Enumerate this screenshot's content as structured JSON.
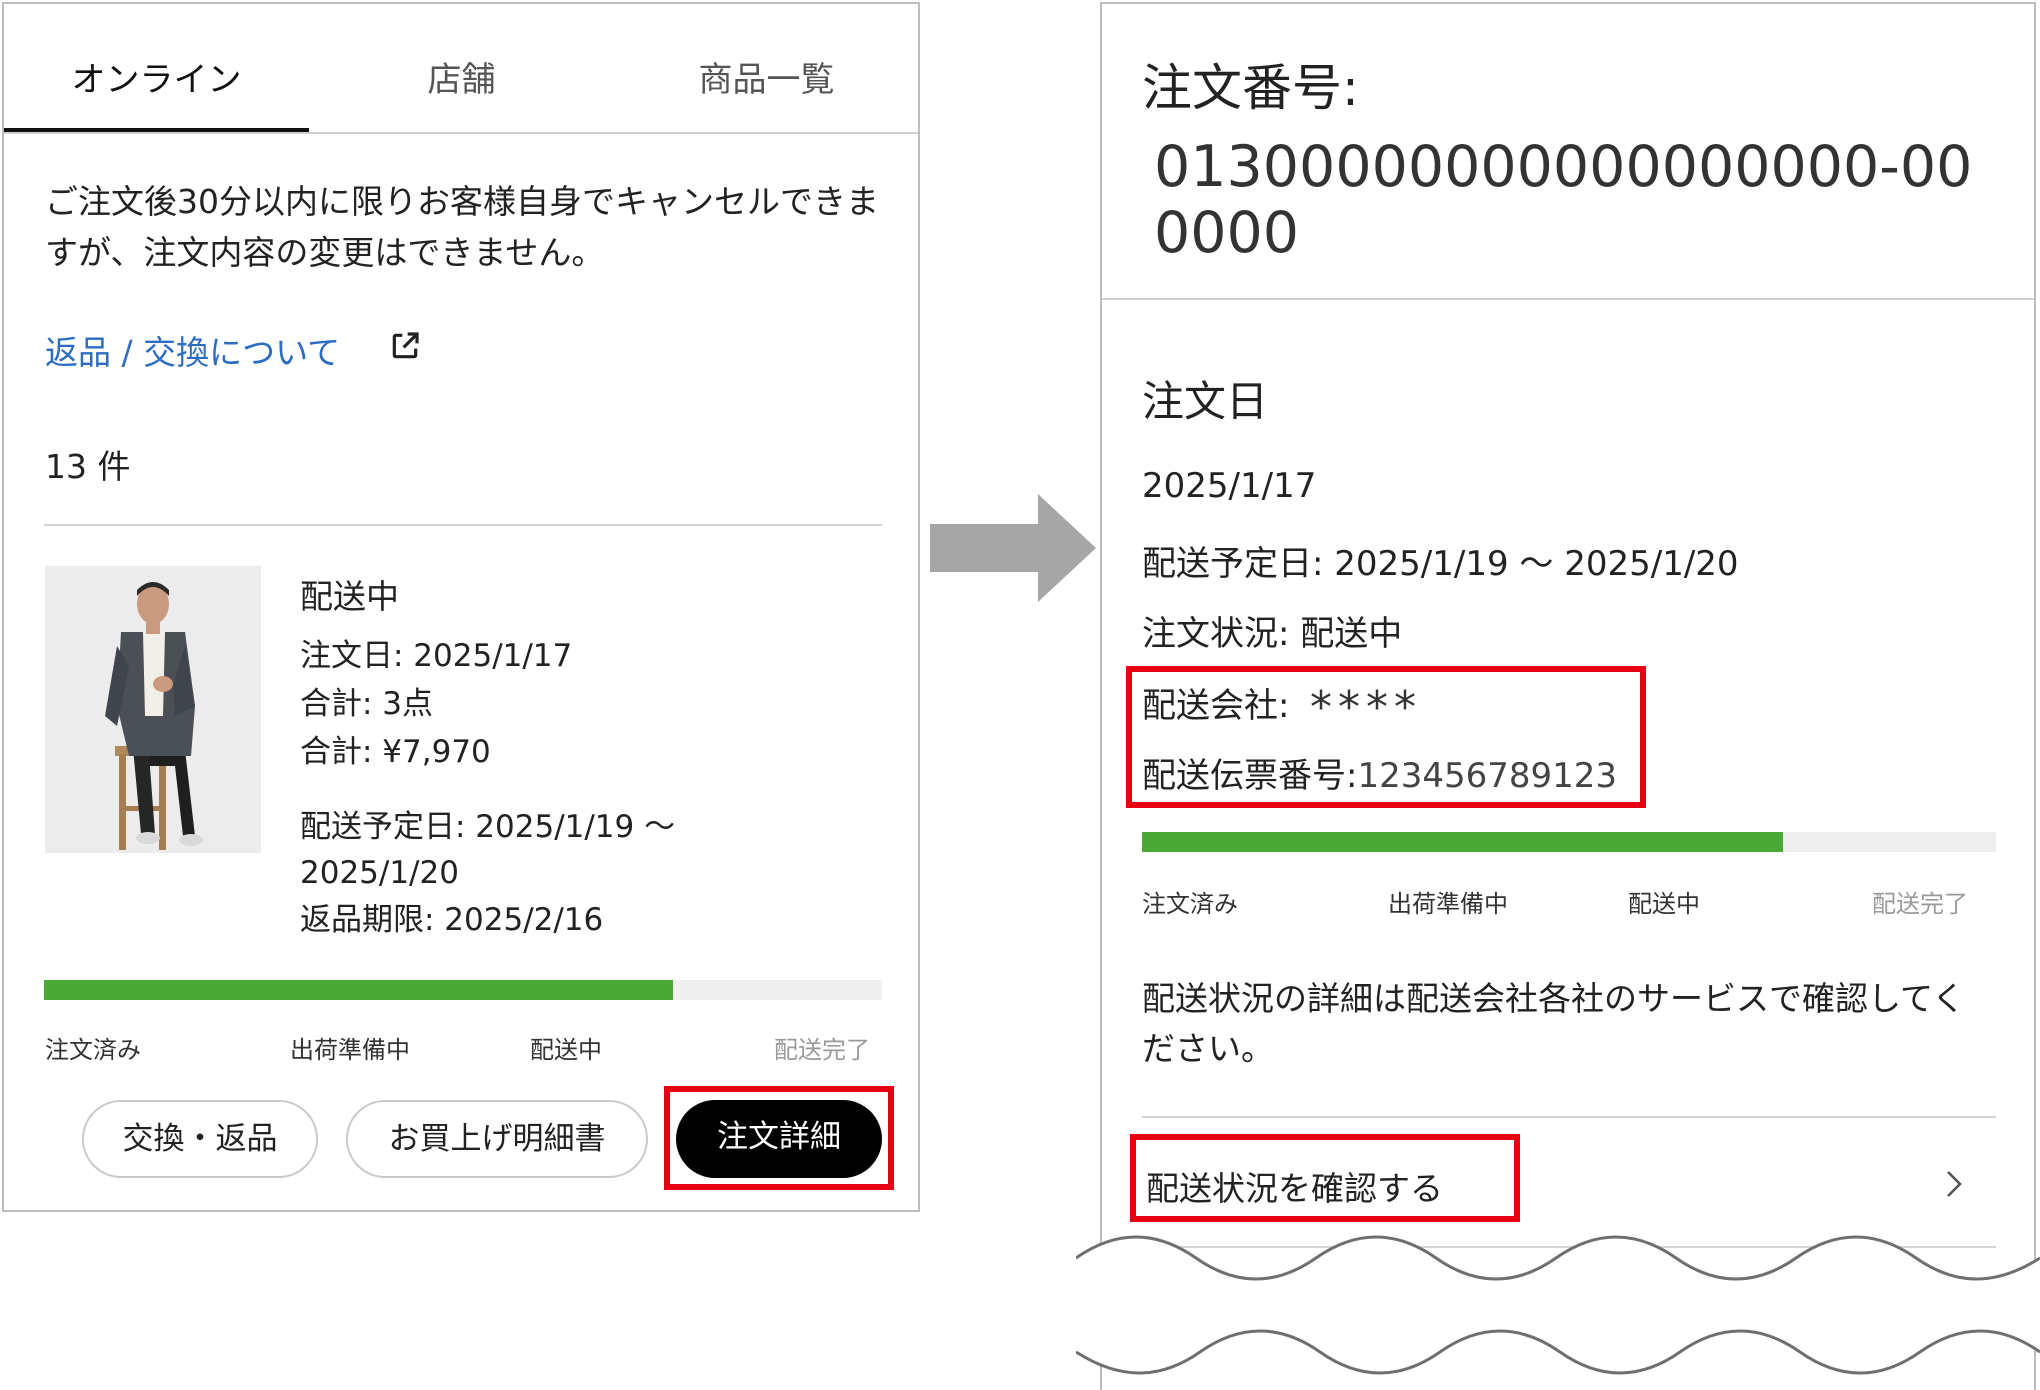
{
  "left": {
    "tabs": [
      {
        "label": "オンライン",
        "active": true
      },
      {
        "label": "店舗",
        "active": false
      },
      {
        "label": "商品一覧",
        "active": false
      }
    ],
    "note": "ご注文後30分以内に限りお客様自身でキャンセルできますが、注文内容の変更はできません。",
    "link": "返品 / 交換について",
    "link_icon": "external-link-icon",
    "count": "13 件",
    "order": {
      "status": "配送中",
      "order_date": "注文日: 2025/1/17",
      "quantity": "合計: 3点",
      "total": "合計: ¥7,970",
      "delivery": "配送予定日: 2025/1/19 〜 2025/1/20",
      "return_limit": "返品期限: 2025/2/16"
    },
    "progress": {
      "fraction": 0.75,
      "labels": [
        "注文済み",
        "出荷準備中",
        "配送中",
        "配送完了"
      ]
    },
    "buttons": {
      "exchange": "交換・返品",
      "receipt": "お買上げ明細書",
      "details": "注文詳細"
    }
  },
  "right": {
    "order_label": "注文番号:",
    "order_number": "01300000000000000000-000000",
    "date_heading": "注文日",
    "date": "2025/1/17",
    "delivery": "配送予定日: 2025/1/19 〜 2025/1/20",
    "status": "注文状況: 配送中",
    "carrier_label": "配送会社:",
    "carrier_value": "****",
    "tracking_label": "配送伝票番号:",
    "tracking_value": "123456789123",
    "progress": {
      "fraction": 0.75,
      "labels": [
        "注文済み",
        "出荷準備中",
        "配送中",
        "配送完了"
      ]
    },
    "note": "配送状況の詳細は配送会社各社のサービスで確認してください。",
    "check_link": "配送状況を確認する"
  },
  "colors": {
    "progress": "#4aa935",
    "highlight": "#e60012",
    "link": "#2c6cc2",
    "arrow": "#a6a6a6"
  }
}
